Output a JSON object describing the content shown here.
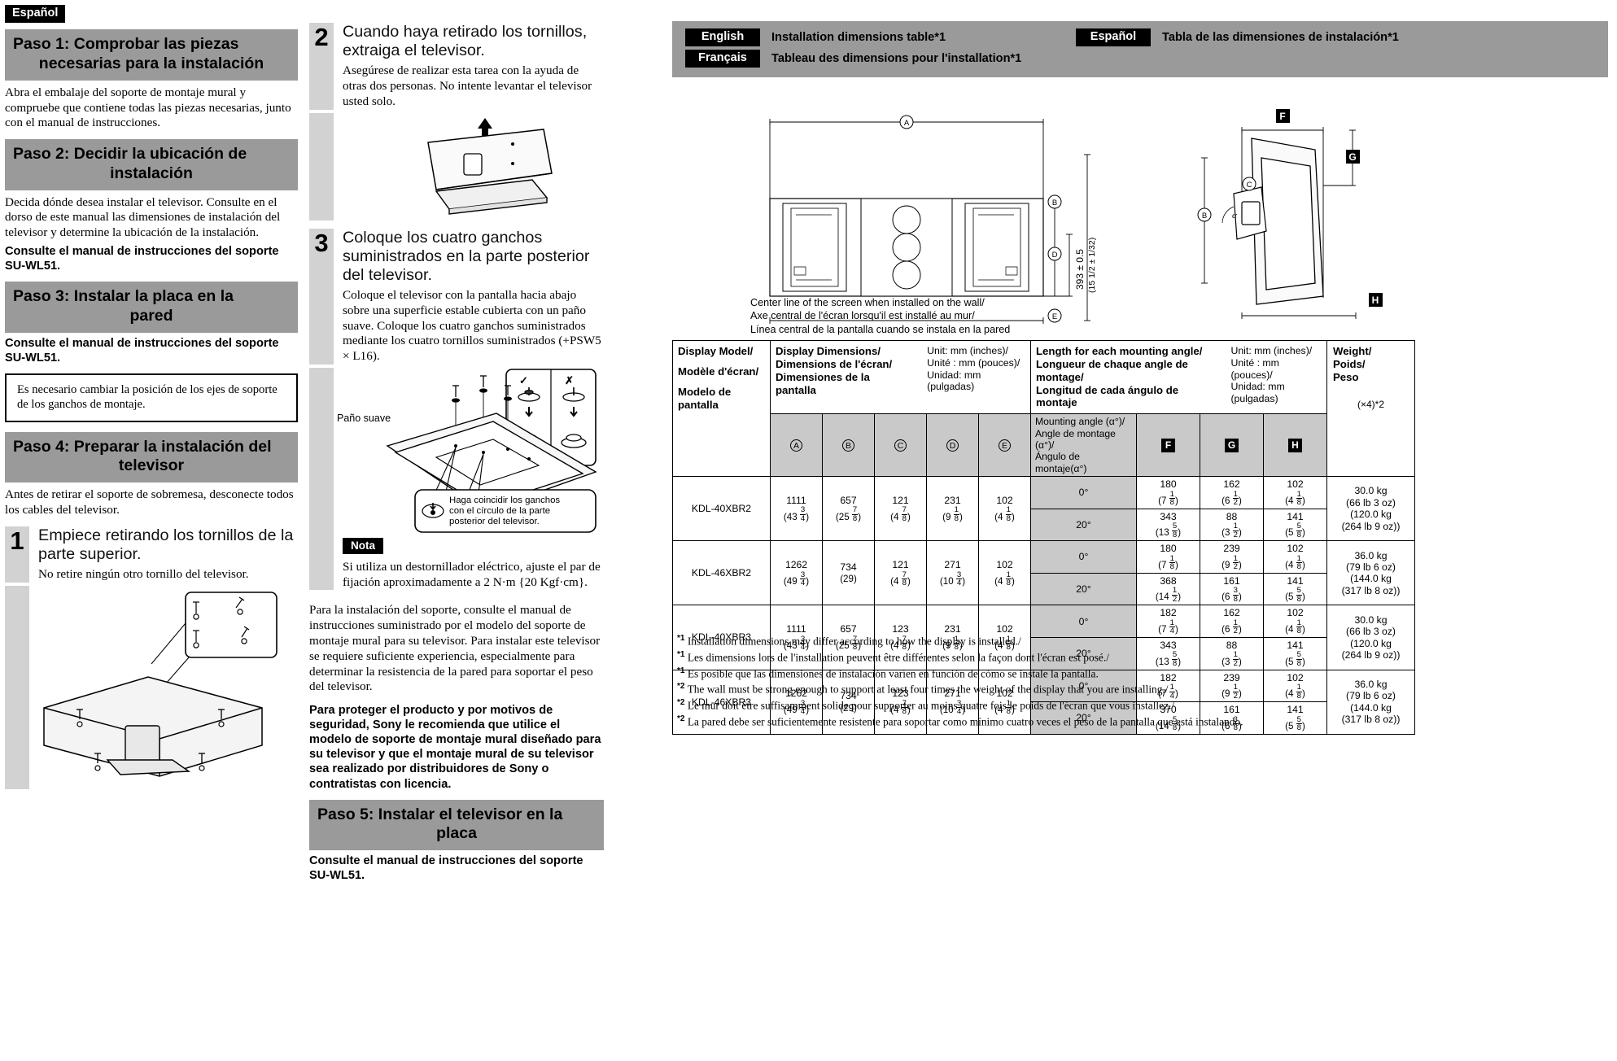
{
  "language_badge": "Español",
  "column1": {
    "step1": {
      "heading_lines": [
        "Paso 1: Comprobar las piezas",
        "necesarias para la",
        "instalación"
      ],
      "body": "Abra el embalaje del soporte de montaje mural y compruebe que contiene todas las piezas necesarias, junto con el manual de instrucciones."
    },
    "step2": {
      "heading_lines": [
        "Paso 2: Decidir la ubicación de",
        "instalación"
      ],
      "body": "Decida dónde desea instalar el televisor. Consulte en el dorso de este manual las dimensiones de instalación del televisor y determine la ubicación de la instalación.",
      "bold_note": "Consulte el manual de instrucciones del soporte SU-WL51."
    },
    "step3": {
      "heading_lines": [
        "Paso 3: Instalar la placa en la",
        "pared"
      ],
      "bold_note": "Consulte el manual de instrucciones del soporte SU-WL51.",
      "framed_note": "Es necesario cambiar la posición de los ejes de soporte de los ganchos de montaje."
    },
    "step4": {
      "heading_lines": [
        "Paso 4: Preparar la instalación del",
        "televisor"
      ],
      "body": "Antes de retirar el soporte de sobremesa, desconecte todos los cables del televisor.",
      "numbered": {
        "number": "1",
        "title": "Empiece retirando los tornillos de la parte superior.",
        "sub": "No retire ningún otro tornillo del televisor."
      }
    }
  },
  "column2": {
    "step_2": {
      "number": "2",
      "title": "Cuando haya retirado los tornillos, extraiga el televisor.",
      "sub": "Asegúrese de realizar esta tarea con la ayuda de otras dos personas. No intente levantar el televisor usted solo."
    },
    "step_3": {
      "number": "3",
      "title": "Coloque los cuatro ganchos suministrados en la parte posterior del televisor.",
      "sub": "Coloque el televisor con la pantalla hacia abajo sobre una superficie estable cubierta con un paño suave. Coloque los cuatro ganchos suministrados mediante los cuatro tornillos suministrados (+PSW5 × L16)."
    },
    "figure_labels": {
      "cloth": "Paño suave",
      "callout": "Haga coincidir los ganchos con el círculo de la parte posterior del televisor.",
      "check_mark": "✓",
      "cross_mark": "✗"
    },
    "nota_badge": "Nota",
    "nota_text": "Si utiliza un destornillador eléctrico, ajuste el par de fijación aproximadamente a 2 N·m {20 Kgf·cm}.",
    "closing_body": "Para la instalación del soporte, consulte el manual de instrucciones suministrado por el modelo del soporte de montaje mural para su televisor. Para instalar este televisor se requiere suficiente experiencia, especialmente para determinar la resistencia de la pared para soportar el peso del televisor.",
    "closing_bold": "Para proteger el producto y por motivos de seguridad, Sony le recomienda que utilice el modelo de soporte de montaje mural diseñado para su televisor y que el montaje mural de su televisor sea realizado por distribuidores de Sony o contratistas con licencia.",
    "step5": {
      "heading_lines": [
        "Paso 5: Instalar el televisor en la",
        "placa"
      ],
      "bold_note": "Consulte el manual de instrucciones del soporte SU-WL51."
    }
  },
  "right_panel": {
    "banner": {
      "rows": [
        {
          "lang": "English",
          "text": "Installation dimensions table*1"
        },
        {
          "lang": "Français",
          "text": "Tableau des dimensions pour l'installation*1"
        }
      ],
      "right_row": {
        "lang": "Español",
        "text": "Tabla de las dimensiones de instalación*1"
      }
    },
    "diagram": {
      "markers": [
        "A",
        "B",
        "C",
        "D",
        "E",
        "F",
        "G",
        "H"
      ],
      "vertical_dim": "393 ± 0.5",
      "vertical_dim_inches": "(15 1/2 ± 1/32)",
      "angle_symbol": "α",
      "center_line_caption": [
        "Center line of the screen when installed on the wall/",
        "Axe central de l'écran lorsqu'il est installé au mur/",
        "Línea central de la pantalla cuando se instala en la pared"
      ]
    },
    "table": {
      "col_model_header": [
        "Display Model/",
        "Modèle d'écran/",
        "Modelo de pantalla"
      ],
      "group_display_dims": [
        "Display Dimensions/",
        "Dimensions de l'écran/",
        "Dimensiones de la pantalla"
      ],
      "group_display_unit": [
        "Unit: mm (inches)/",
        "Unité : mm (pouces)/",
        "Unidad: mm (pulgadas)"
      ],
      "group_length": [
        "Length for each mounting angle/",
        "Longueur de chaque angle de montage/",
        "Longitud de cada ángulo de montaje"
      ],
      "group_length_unit": [
        "Unit: mm (inches)/",
        "Unité : mm (pouces)/",
        "Unidad: mm (pulgadas)"
      ],
      "group_weight": [
        "Weight/",
        "Poids/",
        "Peso"
      ],
      "weight_multiplier": "(×4)*2",
      "dim_cols": [
        "A",
        "B",
        "C",
        "D",
        "E"
      ],
      "angle_header": [
        "Mounting angle (α°)/",
        "Angle de montage (α°)/",
        "Ángulo de montaje(α°)"
      ],
      "len_cols": [
        "F",
        "G",
        "H"
      ],
      "rows": [
        {
          "model": "KDL-40XBR2",
          "dims": [
            {
              "mm": "1111",
              "in": "(43 3/4)"
            },
            {
              "mm": "657",
              "in": "(25 7/8)"
            },
            {
              "mm": "121",
              "in": "(4 7/8)"
            },
            {
              "mm": "231",
              "in": "(9 1/8)"
            },
            {
              "mm": "102",
              "in": "(4 1/8)"
            }
          ],
          "angles": [
            {
              "angle": "0°",
              "lengths": [
                {
                  "mm": "180",
                  "in": "(7 1/8)"
                },
                {
                  "mm": "162",
                  "in": "(6 1/2)"
                },
                {
                  "mm": "102",
                  "in": "(4 1/8)"
                }
              ]
            },
            {
              "angle": "20°",
              "lengths": [
                {
                  "mm": "343",
                  "in": "(13 5/8)"
                },
                {
                  "mm": "88",
                  "in": "(3 1/2)"
                },
                {
                  "mm": "141",
                  "in": "(5 5/8)"
                }
              ]
            }
          ],
          "weight": [
            "30.0 kg",
            "(66 lb 3 oz)",
            "(120.0 kg",
            "(264 lb 9 oz))"
          ]
        },
        {
          "model": "KDL-46XBR2",
          "dims": [
            {
              "mm": "1262",
              "in": "(49 3/4)"
            },
            {
              "mm": "734",
              "in": "(29)"
            },
            {
              "mm": "121",
              "in": "(4 7/8)"
            },
            {
              "mm": "271",
              "in": "(10 3/4)"
            },
            {
              "mm": "102",
              "in": "(4 1/8)"
            }
          ],
          "angles": [
            {
              "angle": "0°",
              "lengths": [
                {
                  "mm": "180",
                  "in": "(7 1/8)"
                },
                {
                  "mm": "239",
                  "in": "(9 1/2)"
                },
                {
                  "mm": "102",
                  "in": "(4 1/8)"
                }
              ]
            },
            {
              "angle": "20°",
              "lengths": [
                {
                  "mm": "368",
                  "in": "(14 1/2)"
                },
                {
                  "mm": "161",
                  "in": "(6 3/8)"
                },
                {
                  "mm": "141",
                  "in": "(5 5/8)"
                }
              ]
            }
          ],
          "weight": [
            "36.0 kg",
            "(79 lb 6 oz)",
            "(144.0 kg",
            "(317 lb 8 oz))"
          ]
        },
        {
          "model": "KDL-40XBR3",
          "dims": [
            {
              "mm": "1111",
              "in": "(43 3/4)"
            },
            {
              "mm": "657",
              "in": "(25 7/8)"
            },
            {
              "mm": "123",
              "in": "(4 7/8)"
            },
            {
              "mm": "231",
              "in": "(9 1/8)"
            },
            {
              "mm": "102",
              "in": "(4 1/8)"
            }
          ],
          "angles": [
            {
              "angle": "0°",
              "lengths": [
                {
                  "mm": "182",
                  "in": "(7 1/4)"
                },
                {
                  "mm": "162",
                  "in": "(6 1/2)"
                },
                {
                  "mm": "102",
                  "in": "(4 1/8)"
                }
              ]
            },
            {
              "angle": "20°",
              "lengths": [
                {
                  "mm": "343",
                  "in": "(13 5/8)"
                },
                {
                  "mm": "88",
                  "in": "(3 1/2)"
                },
                {
                  "mm": "141",
                  "in": "(5 5/8)"
                }
              ]
            }
          ],
          "weight": [
            "30.0 kg",
            "(66 lb 3 oz)",
            "(120.0 kg",
            "(264 lb 9 oz))"
          ]
        },
        {
          "model": "KDL-46XBR3",
          "dims": [
            {
              "mm": "1262",
              "in": "(49 3/4)"
            },
            {
              "mm": "734",
              "in": "(29)"
            },
            {
              "mm": "123",
              "in": "(4 7/8)"
            },
            {
              "mm": "271",
              "in": "(10 3/4)"
            },
            {
              "mm": "102",
              "in": "(4 1/8)"
            }
          ],
          "angles": [
            {
              "angle": "0°",
              "lengths": [
                {
                  "mm": "182",
                  "in": "(7 1/4)"
                },
                {
                  "mm": "239",
                  "in": "(9 1/2)"
                },
                {
                  "mm": "102",
                  "in": "(4 1/8)"
                }
              ]
            },
            {
              "angle": "20°",
              "lengths": [
                {
                  "mm": "370",
                  "in": "(14 5/8)"
                },
                {
                  "mm": "161",
                  "in": "(6 3/8)"
                },
                {
                  "mm": "141",
                  "in": "(5 5/8)"
                }
              ]
            }
          ],
          "weight": [
            "36.0 kg",
            "(79 lb 6 oz)",
            "(144.0 kg",
            "(317 lb 8 oz))"
          ]
        }
      ]
    },
    "footnotes": [
      {
        "mark": "*1",
        "text": "Installation dimensions may differ according to how the display is installed./"
      },
      {
        "mark": "*1",
        "text": "Les dimensions lors de l'installation peuvent être différentes selon la façon dont l'écran est posé./"
      },
      {
        "mark": "*1",
        "text": "Es posible que las dimensiones de instalación varíen en función de cómo se instale la pantalla."
      },
      {
        "mark": "*2",
        "text": "The wall must be strong enough to support at least four times the weight of the display that you are installing./"
      },
      {
        "mark": "*2",
        "text": "Le mur doit être suffisamment solide pour supporter au moins quatre fois le poids de l'écran que vous installez./"
      },
      {
        "mark": "*2",
        "text": "La pared debe ser suficientemente resistente para soportar como mínimo cuatro veces el peso de la pantalla que está instalando."
      }
    ]
  },
  "colors": {
    "heading_gray": "#9a9a9a",
    "rail_gray": "#d2d2d2",
    "table_shade": "#c9c9c9",
    "badge_black": "#000000"
  }
}
